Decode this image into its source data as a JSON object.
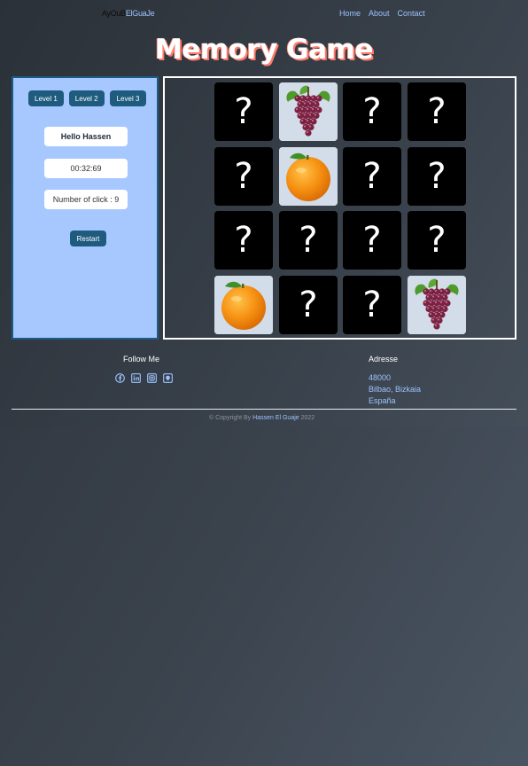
{
  "navbar": {
    "brand_part1": "AyOuB",
    "brand_part2": "ElGuaJe",
    "links": [
      "Home",
      "About",
      "Contact"
    ]
  },
  "title": "Memory Game",
  "panel": {
    "levels": [
      "Level 1",
      "Level 2",
      "Level 3"
    ],
    "greeting": "Hello Hassen",
    "timer": "00:32:69",
    "clicks": "Number of click : 9",
    "restart_label": "Restart"
  },
  "board": {
    "hidden_symbol": "?",
    "cards": [
      [
        "hidden",
        "grapes",
        "hidden",
        "hidden"
      ],
      [
        "hidden",
        "orange",
        "hidden",
        "hidden"
      ],
      [
        "hidden",
        "hidden",
        "hidden",
        "hidden"
      ],
      [
        "orange",
        "hidden",
        "hidden",
        "grapes"
      ]
    ]
  },
  "footer": {
    "follow_title": "Follow Me",
    "social_icons": [
      "facebook-icon",
      "linkedin-icon",
      "instagram-icon",
      "github-icon"
    ],
    "address_title": "Adresse",
    "address_lines": [
      "48000",
      "Bilbao, Bizkaia",
      "España"
    ],
    "copyright_prefix": "© Copyright By",
    "copyright_name": "Hassen El Guaje",
    "copyright_year": "2022"
  },
  "colors": {
    "accent": "#9cc3ff",
    "panel_bg": "#a6c8ff",
    "button_bg": "#1f5b7e",
    "card_back": "#000000"
  }
}
